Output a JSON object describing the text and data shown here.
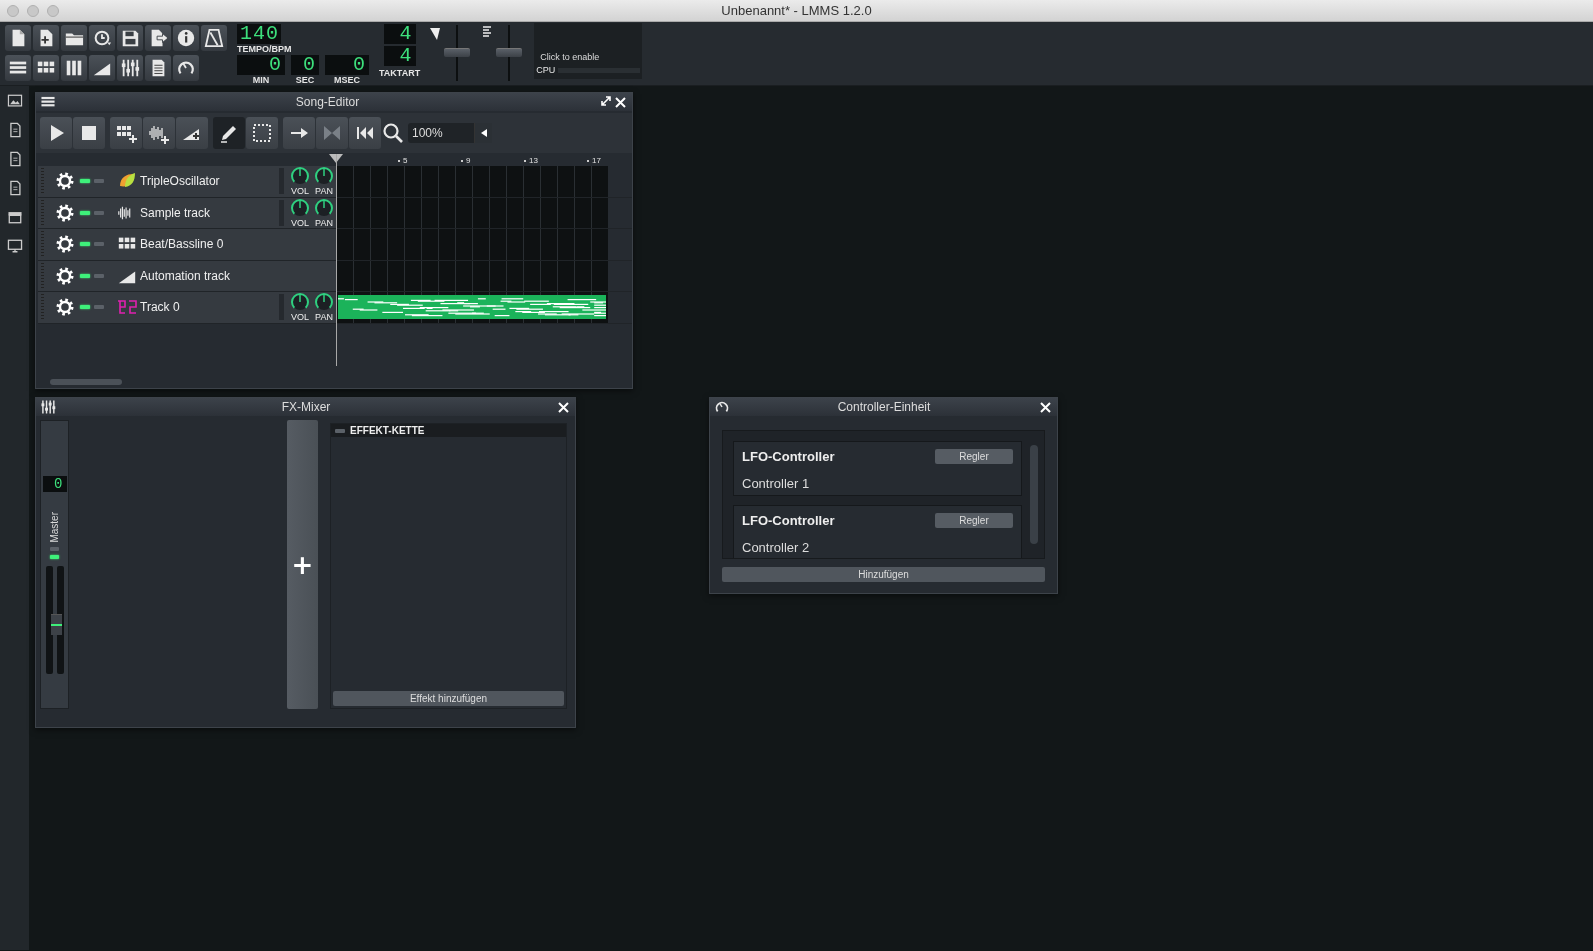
{
  "window": {
    "title": "Unbenannt* - LMMS 1.2.0"
  },
  "toolbar": {
    "tempo": {
      "value": "140",
      "label": "TEMPO/BPM"
    },
    "time": [
      {
        "value": "0",
        "label": "MIN"
      },
      {
        "value": "0",
        "label": "SEC"
      },
      {
        "value": "0",
        "label": "MSEC"
      }
    ],
    "time_signature": {
      "numerator": "4",
      "denominator": "4",
      "label": "TAKTART"
    },
    "master_volume": {
      "level": 0.5
    },
    "master_pitch": {
      "level": 0.5
    },
    "cpu": {
      "hint": "Click to enable",
      "label": "CPU"
    }
  },
  "song_editor": {
    "title": "Song-Editor",
    "zoom": "100%",
    "edit_modes": [
      {
        "kind": "draw",
        "selected": true
      },
      {
        "kind": "select",
        "selected": false
      }
    ],
    "ruler": [
      "5",
      "9",
      "13",
      "17"
    ],
    "tracks": [
      {
        "kind": "instrument",
        "name": "TripleOscillator",
        "muted": false,
        "knobs": [
          "VOL",
          "PAN"
        ],
        "clip": false
      },
      {
        "kind": "sample",
        "name": "Sample track",
        "muted": false,
        "knobs": [
          "VOL",
          "PAN"
        ],
        "clip": false
      },
      {
        "kind": "beat",
        "name": "Beat/Bassline 0",
        "muted": false,
        "clip": false
      },
      {
        "kind": "automation",
        "name": "Automation track",
        "muted": false,
        "clip": false
      },
      {
        "kind": "midi",
        "name": "Track 0",
        "muted": false,
        "knobs": [
          "VOL",
          "PAN"
        ],
        "clip": true
      }
    ]
  },
  "fx_mixer": {
    "title": "FX-Mixer",
    "channels": [
      {
        "number": "0",
        "name": "Master",
        "muted": false,
        "level": 0.45
      }
    ],
    "add_channel": "+",
    "effects": {
      "header": "EFFEKT-KETTE",
      "enabled": false,
      "add": "Effekt hinzufügen"
    }
  },
  "controller_rack": {
    "title": "Controller-Einheit",
    "controllers": [
      {
        "type": "LFO-Controller",
        "name": "Controller 1",
        "button": "Regler"
      },
      {
        "type": "LFO-Controller",
        "name": "Controller 2",
        "button": "Regler"
      }
    ],
    "add": "Hinzufügen"
  }
}
